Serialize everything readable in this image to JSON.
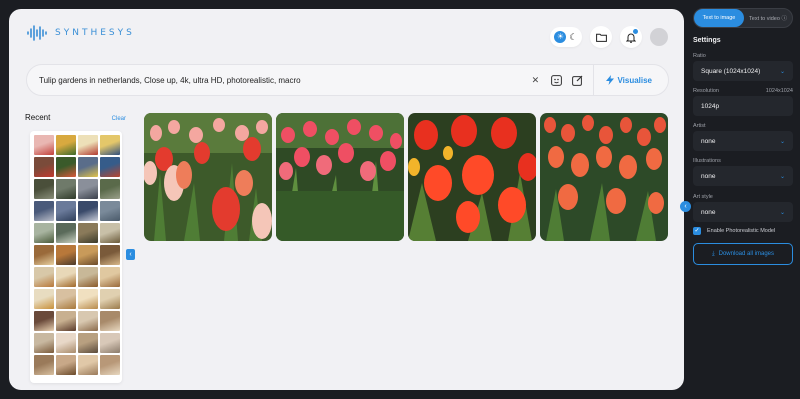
{
  "brand": {
    "name": "SYNTHESYS",
    "color": "#3a8fd6"
  },
  "accent": "#2b8de0",
  "header": {
    "theme_light_icon": "sun-icon",
    "theme_dark_icon": "moon-icon",
    "folder_icon": "folder-icon",
    "bell_icon": "bell-icon"
  },
  "prompt": {
    "text": "Tulip gardens in netherlands, Close up, 4k, ultra HD, photorealistic, macro",
    "visualise_label": "Visualise"
  },
  "recent": {
    "title": "Recent",
    "clear_label": "Clear"
  },
  "sidebar": {
    "mode_tabs": [
      "Text to image",
      "Text to video"
    ],
    "active_tab": "Text to image",
    "settings_title": "Settings",
    "ratio": {
      "label": "Ratio",
      "value": "Square (1024x1024)"
    },
    "resolution": {
      "label": "Resolution",
      "hint": "1024x1024",
      "value": "1024p"
    },
    "artist": {
      "label": "Artist",
      "value": "none"
    },
    "illustrations": {
      "label": "Illustrations",
      "value": "none"
    },
    "art_style": {
      "label": "Art style",
      "value": "none"
    },
    "photorealistic": {
      "label": "Enable Photorealistic Model",
      "checked": true
    },
    "download_label": "Download all images"
  }
}
